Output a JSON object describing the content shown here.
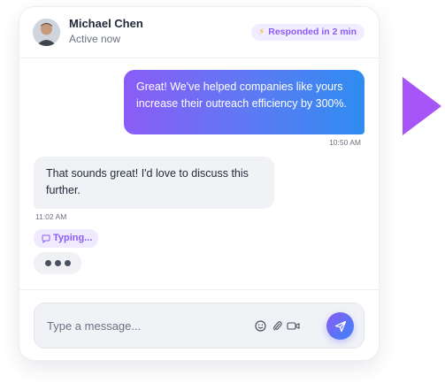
{
  "contact": {
    "name": "Michael Chen",
    "status": "Active now"
  },
  "response_badge": {
    "icon": "lightning-icon",
    "text": "Responded in 2 min"
  },
  "messages": [
    {
      "direction": "outgoing",
      "text": "Great! We've helped companies like yours increase their outreach efficiency by 300%.",
      "time": "10:50 AM"
    },
    {
      "direction": "incoming",
      "text": "That sounds great! I'd love to discuss this further.",
      "time": "11:02 AM"
    }
  ],
  "typing": {
    "label": "Typing..."
  },
  "composer": {
    "placeholder": "Type a message...",
    "icons": [
      "emoji-icon",
      "attachment-icon",
      "video-icon",
      "send-icon"
    ]
  },
  "colors": {
    "accent": "#8b5cf6",
    "gradient_start": "#8b5cf6",
    "gradient_end": "#2f8cf0",
    "arrow": "#a855f7"
  }
}
